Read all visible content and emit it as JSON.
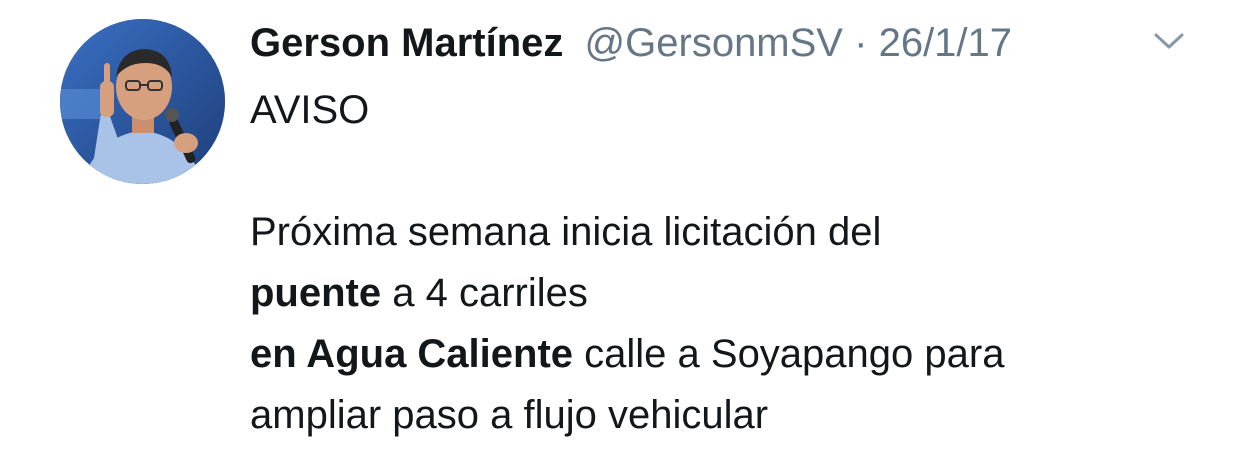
{
  "tweet": {
    "author_name": "Gerson Martínez",
    "handle": "@GersonmSV",
    "separator": "·",
    "date": "26/1/17",
    "lines": [
      {
        "segments": [
          {
            "text": "AVISO",
            "bold": false
          }
        ]
      },
      {
        "segments": []
      },
      {
        "segments": [
          {
            "text": "Próxima semana inicia licitación del",
            "bold": false
          }
        ]
      },
      {
        "segments": [
          {
            "text": "puente",
            "bold": true
          },
          {
            "text": " a 4 carriles",
            "bold": false
          }
        ]
      },
      {
        "segments": [
          {
            "text": "en Agua Caliente",
            "bold": true
          },
          {
            "text": " calle a Soyapango para",
            "bold": false
          }
        ]
      },
      {
        "segments": [
          {
            "text": "ampliar paso a flujo vehicular",
            "bold": false
          }
        ]
      }
    ]
  },
  "icons": {
    "avatar": "profile-photo",
    "menu": "chevron-down-icon"
  },
  "colors": {
    "text": "#14171a",
    "secondary": "#657786",
    "background": "#ffffff"
  }
}
